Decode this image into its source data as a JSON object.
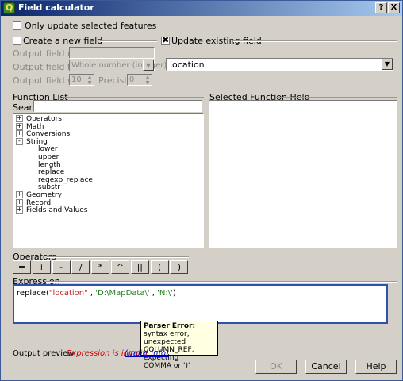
{
  "window": {
    "title": "Field calculator",
    "help_btn": "?",
    "close_btn": "X"
  },
  "only_update_label": "Only update selected features",
  "create_field": {
    "label": "Create a new field",
    "output_name_label": "Output field name",
    "output_type_label": "Output field type",
    "output_type_value": "Whole number (integer)",
    "output_width_label": "Output field width",
    "output_width_value": "10",
    "precision_label": "Precision",
    "precision_value": "0"
  },
  "update_field": {
    "label": "Update existing field",
    "value": "location"
  },
  "function_list": {
    "label": "Function List",
    "search_label": "Search",
    "tree": [
      {
        "label": "Operators",
        "kind": "group",
        "expander": "+"
      },
      {
        "label": "Math",
        "kind": "group",
        "expander": "+"
      },
      {
        "label": "Conversions",
        "kind": "group",
        "expander": "+"
      },
      {
        "label": "String",
        "kind": "group",
        "expander": "-"
      },
      {
        "label": "lower",
        "kind": "child"
      },
      {
        "label": "upper",
        "kind": "child"
      },
      {
        "label": "length",
        "kind": "child"
      },
      {
        "label": "replace",
        "kind": "child"
      },
      {
        "label": "regexp_replace",
        "kind": "child"
      },
      {
        "label": "substr",
        "kind": "child"
      },
      {
        "label": "Geometry",
        "kind": "group",
        "expander": "+"
      },
      {
        "label": "Record",
        "kind": "group",
        "expander": "+"
      },
      {
        "label": "Fields and Values",
        "kind": "group",
        "expander": "+"
      }
    ]
  },
  "help_panel": {
    "label": "Selected Function Help"
  },
  "operators": {
    "label": "Operators",
    "buttons": [
      "=",
      "+",
      "-",
      "/",
      "*",
      "^",
      "||",
      "(",
      ")"
    ]
  },
  "expression": {
    "label": "Expression",
    "parts": [
      {
        "text": "replace(",
        "color": "#000000"
      },
      {
        "text": "\"location\"",
        "color": "#c02020"
      },
      {
        "text": " , ",
        "color": "#000000"
      },
      {
        "text": "'D:\\MapData\\'",
        "color": "#208020"
      },
      {
        "text": " , ",
        "color": "#000000"
      },
      {
        "text": "'N:\\'",
        "color": "#208020"
      },
      {
        "text": ")",
        "color": "#000000"
      }
    ]
  },
  "tooltip": {
    "title": "Parser Error:",
    "lines": [
      "syntax error, unexpected",
      "COLUMN_REF, expecting",
      "COMMA or ')'"
    ]
  },
  "preview": {
    "label": "Output preview:",
    "error": "Expression is invalid",
    "more_info": "(more info)"
  },
  "buttons": {
    "ok": "OK",
    "cancel": "Cancel",
    "help": "Help"
  },
  "colors": {
    "error_red": "#cc0000",
    "link_blue": "#0000cc",
    "expr_border": "#3050b0"
  }
}
